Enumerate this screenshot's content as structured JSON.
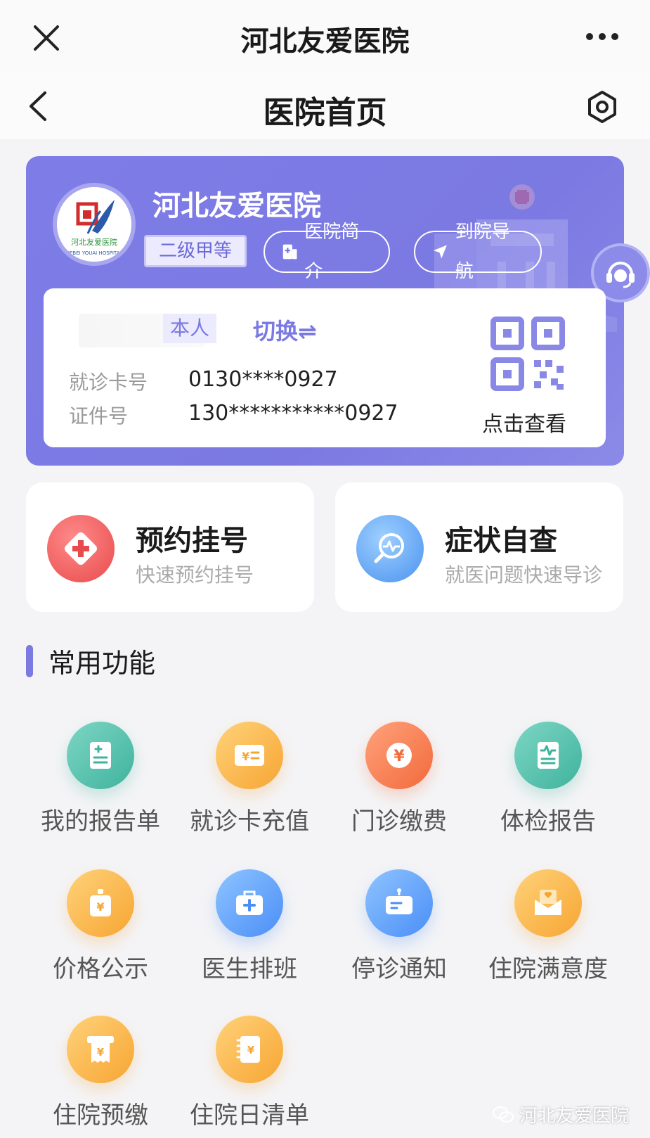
{
  "window": {
    "title": "河北友爱医院"
  },
  "navbar": {
    "title": "医院首页"
  },
  "hero": {
    "hospital_name": "河北友爱医院",
    "level": "二级甲等",
    "intro_label": "医院简介",
    "nav_label": "到院导航",
    "logo_text": "河北友爱医院",
    "logo_subtext": "HEBEI YOUAI HOSPITAL"
  },
  "patient_card": {
    "self_tag": "本人",
    "switch_label": "切换⇌",
    "card_no_label": "就诊卡号",
    "card_no": "0130****0927",
    "id_label": "证件号",
    "id_no": "130***********0927",
    "qr_label": "点击查看"
  },
  "quick_tiles": [
    {
      "title": "预约挂号",
      "subtitle": "快速预约挂号",
      "icon": "medical-cross-icon"
    },
    {
      "title": "症状自查",
      "subtitle": "就医问题快速导诊",
      "icon": "search-pulse-icon"
    }
  ],
  "section": {
    "title": "常用功能"
  },
  "functions": [
    {
      "label": "我的报告单",
      "icon": "report-icon"
    },
    {
      "label": "就诊卡充值",
      "icon": "card-recharge-icon"
    },
    {
      "label": "门诊缴费",
      "icon": "yuan-icon"
    },
    {
      "label": "体检报告",
      "icon": "checkup-report-icon"
    },
    {
      "label": "价格公示",
      "icon": "price-bag-icon"
    },
    {
      "label": "医生排班",
      "icon": "doctor-bag-icon"
    },
    {
      "label": "停诊通知",
      "icon": "notice-icon"
    },
    {
      "label": "住院满意度",
      "icon": "satisfaction-icon"
    },
    {
      "label": "住院预缴",
      "icon": "prepay-icon"
    },
    {
      "label": "住院日清单",
      "icon": "daily-bill-icon"
    }
  ],
  "watermark": {
    "text": "河北友爱医院"
  },
  "colors": {
    "accent": "#7b79e2",
    "green": "#3fb39d",
    "orange": "#f7a532",
    "red": "#f26a3c",
    "blue": "#4b8ef7"
  }
}
